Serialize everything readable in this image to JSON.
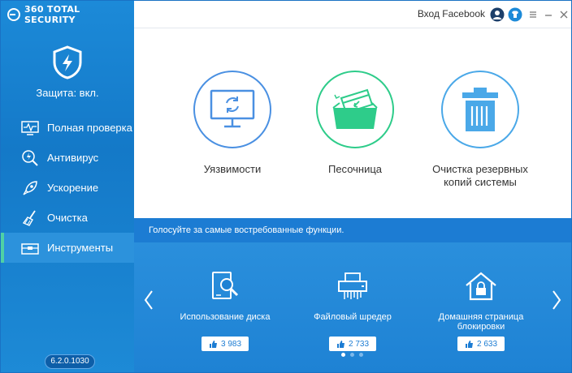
{
  "app": {
    "brand": "360 TOTAL SECURITY",
    "protection_status": "Защита: вкл.",
    "version": "6.2.0.1030"
  },
  "topbar": {
    "facebook_login": "Вход Facebook",
    "icons": [
      "user-icon",
      "shirt-icon",
      "menu-icon",
      "minimize-icon",
      "close-icon"
    ]
  },
  "sidebar": {
    "items": [
      {
        "label": "Полная проверка",
        "icon": "monitor-pulse-icon"
      },
      {
        "label": "Антивирус",
        "icon": "magnifier-bolt-icon"
      },
      {
        "label": "Ускорение",
        "icon": "rocket-icon"
      },
      {
        "label": "Очистка",
        "icon": "broom-icon"
      },
      {
        "label": "Инструменты",
        "icon": "toolbox-icon",
        "active": true
      }
    ]
  },
  "tools": [
    {
      "label": "Уязвимости",
      "icon": "monitor-refresh-icon",
      "color": "#4a90e2"
    },
    {
      "label": "Песочница",
      "icon": "sandbox-icon",
      "color": "#2ecc8a"
    },
    {
      "label": "Очистка резервных копий системы",
      "icon": "trash-icon",
      "color": "#4aa8e8"
    }
  ],
  "vote": {
    "banner": "Голосуйте за самые востребованные функции.",
    "features": [
      {
        "label": "Использование диска",
        "likes": "3 983",
        "icon": "disk-search-icon"
      },
      {
        "label": "Файловый шредер",
        "likes": "2 733",
        "icon": "shredder-icon"
      },
      {
        "label": "Домашняя страница блокировки",
        "likes": "2 633",
        "icon": "home-lock-icon"
      }
    ],
    "page": 1,
    "pages": 3
  },
  "colors": {
    "sidebar": "#1479c8",
    "accent_green": "#4fd1a5",
    "vote_band": "#1c7cd3"
  }
}
